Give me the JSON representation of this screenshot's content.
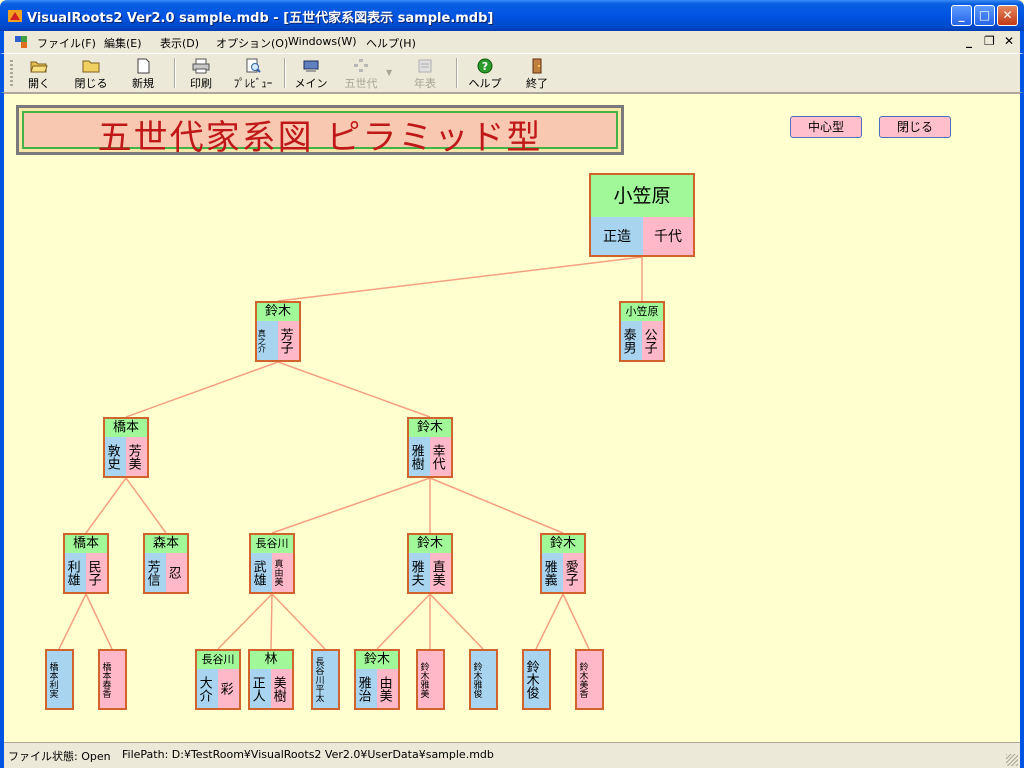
{
  "window": {
    "title": "VisualRoots2  Ver2.0 sample.mdb - [五世代家系図表示  sample.mdb]",
    "controls": {
      "minimize": "_",
      "maximize": "□",
      "close": "✕"
    }
  },
  "menu": {
    "items": [
      "ファイル(F)",
      "編集(E)",
      "表示(D)",
      "オプション(O)",
      "Windows(W)",
      "ヘルプ(H)"
    ],
    "mdi_controls": [
      "_",
      "❐",
      "✕"
    ]
  },
  "toolbar": {
    "buttons": [
      {
        "label": "開く",
        "icon": "folder-open-icon",
        "enabled": true
      },
      {
        "label": "閉じる",
        "icon": "folder-icon",
        "enabled": true
      },
      {
        "label": "新規",
        "icon": "new-document-icon",
        "enabled": true
      },
      {
        "label": "印刷",
        "icon": "printer-icon",
        "enabled": true
      },
      {
        "label": "ﾌﾟﾚﾋﾞｭｰ",
        "icon": "print-preview-icon",
        "enabled": true
      },
      {
        "label": "メイン",
        "icon": "main-icon",
        "enabled": true
      },
      {
        "label": "五世代",
        "icon": "tree-icon",
        "enabled": false
      },
      {
        "label": "年表",
        "icon": "chronology-icon",
        "enabled": false
      },
      {
        "label": "ヘルプ",
        "icon": "help-icon",
        "enabled": true
      },
      {
        "label": "終了",
        "icon": "exit-door-icon",
        "enabled": true
      }
    ]
  },
  "page": {
    "banner_title": "五世代家系図  ピラミッド型",
    "buttons": {
      "center_type": "中心型",
      "close": "閉じる"
    }
  },
  "tree": {
    "gen1": {
      "surname": "小笠原",
      "husband": "正造",
      "wife": "千代"
    },
    "gen2": [
      {
        "surname": "鈴木",
        "husband": "真之介",
        "wife": "芳子"
      },
      {
        "surname": "小笠原",
        "husband": "泰男",
        "wife": "公子"
      }
    ],
    "gen3": [
      {
        "surname": "橋本",
        "husband": "敦史",
        "wife": "芳美"
      },
      {
        "surname": "鈴木",
        "husband": "雅樹",
        "wife": "幸代"
      }
    ],
    "gen4": [
      {
        "surname": "橋本",
        "husband": "利雄",
        "wife": "民子"
      },
      {
        "surname": "森本",
        "husband": "芳信",
        "wife": "忍"
      },
      {
        "surname": "長谷川",
        "husband": "武雄",
        "wife": "真由美"
      },
      {
        "surname": "鈴木",
        "husband": "雅夫",
        "wife": "直美"
      },
      {
        "surname": "鈴木",
        "husband": "雅義",
        "wife": "愛子"
      }
    ],
    "gen5": [
      {
        "name": "橋本利実",
        "gender": "male"
      },
      {
        "name": "橋本春香",
        "gender": "female"
      },
      {
        "surname": "長谷川",
        "husband": "大介",
        "wife": "彩"
      },
      {
        "surname": "林",
        "husband": "正人",
        "wife": "美樹"
      },
      {
        "name": "長谷川平太",
        "gender": "male"
      },
      {
        "surname": "鈴木",
        "husband": "雅治",
        "wife": "由美"
      },
      {
        "name": "鈴木雅美",
        "gender": "female"
      },
      {
        "name": "鈴木雅俊",
        "gender": "male"
      },
      {
        "name": "鈴木俊",
        "gender": "male"
      },
      {
        "name": "鈴木美香",
        "gender": "female"
      }
    ]
  },
  "colors": {
    "background": "#ffffd0",
    "surname_band": "#a0f898",
    "husband": "#a8d4f0",
    "wife": "#ffb8c8",
    "node_border": "#d0642c",
    "line": "#f4a080",
    "banner_text": "#c01818"
  },
  "status": {
    "file_state": "ファイル状態: Open",
    "file_path": "FilePath: D:¥TestRoom¥VisualRoots2 Ver2.0¥UserData¥sample.mdb"
  }
}
